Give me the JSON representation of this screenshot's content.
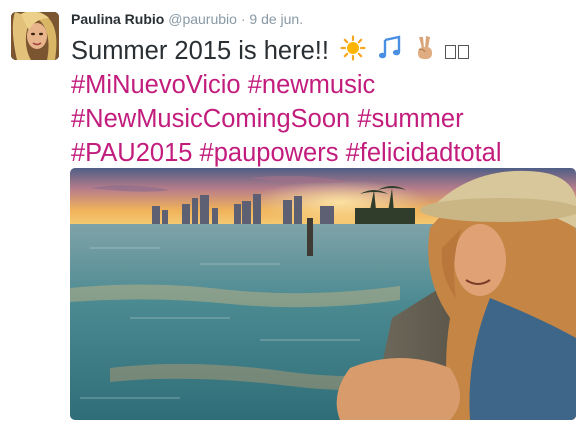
{
  "tweet": {
    "author_name": "Paulina Rubio",
    "handle": "@paurubio",
    "separator": "·",
    "time": "9 de jun.",
    "text_start": "Summer 2015 is here!!",
    "emoji_names": [
      "sun-emoji",
      "musical-notes-emoji",
      "victory-hand-emoji",
      "missing-glyph-box",
      "missing-glyph-box"
    ],
    "hashtags": [
      [
        "#MiNuevoVicio",
        "#newmusic"
      ],
      [
        "#NewMusicComingSoon",
        "#summer"
      ],
      [
        "#PAU2015",
        "#paupowers",
        "#felicidadtotal"
      ]
    ]
  },
  "colors": {
    "hashtag": "#c21c7d",
    "name": "#292f33",
    "meta": "#8899a6",
    "text": "#292f33"
  }
}
